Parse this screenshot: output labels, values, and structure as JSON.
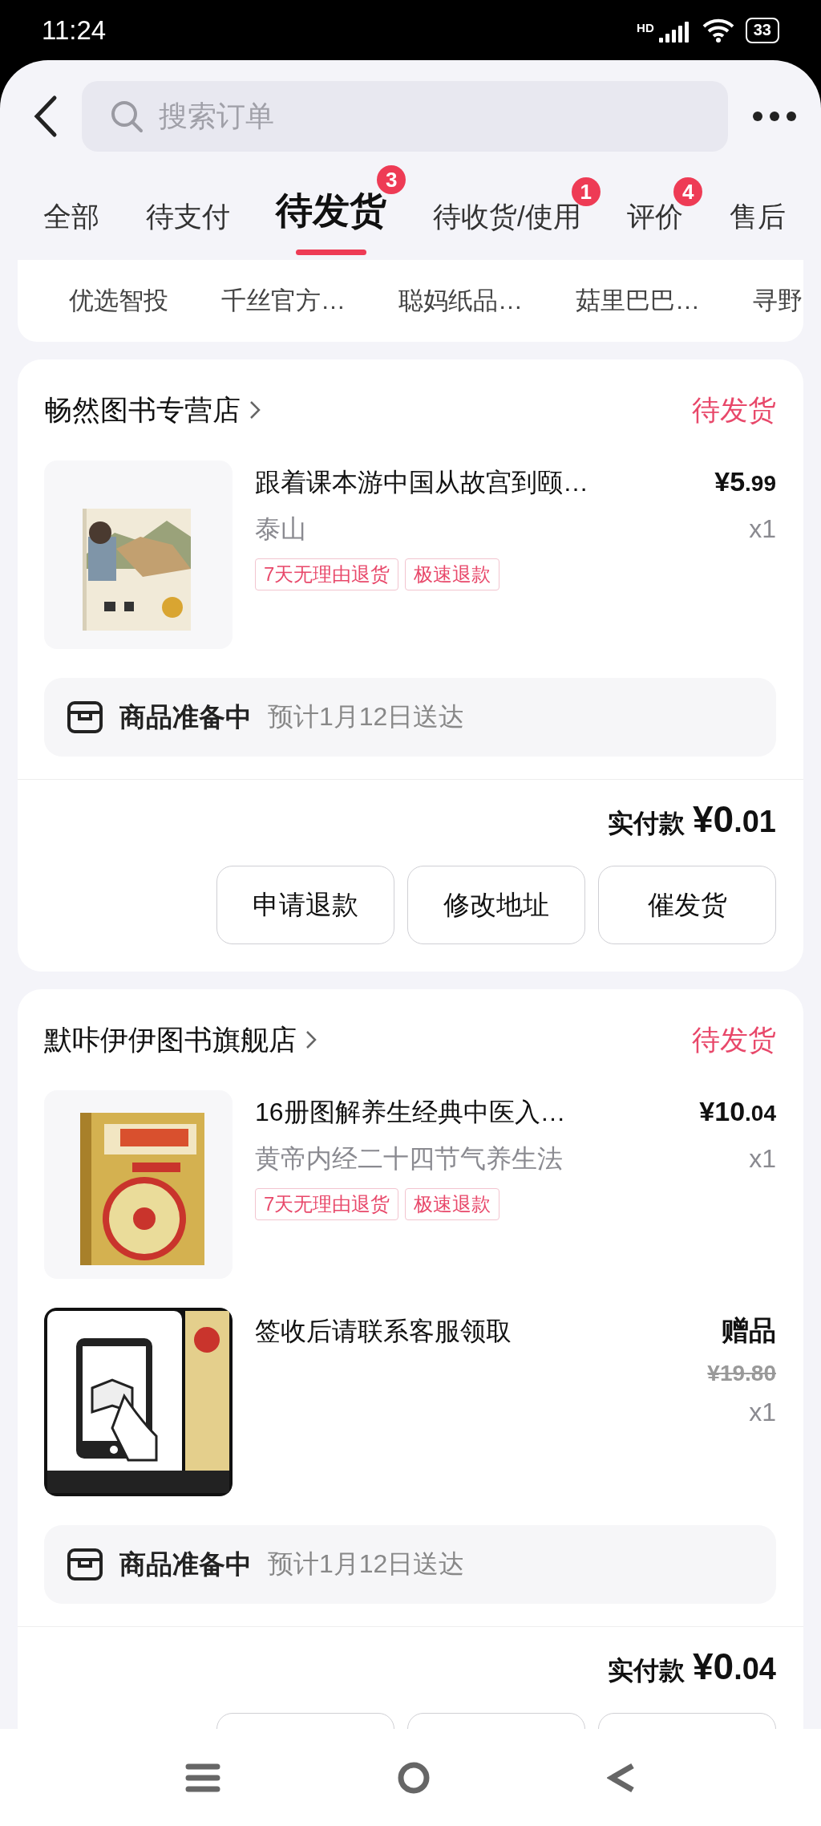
{
  "status_bar": {
    "time": "11:24",
    "network": "HD",
    "battery": "33"
  },
  "header": {
    "search": {
      "placeholder": "搜索订单"
    }
  },
  "tabs": [
    {
      "label": "全部",
      "selected": false
    },
    {
      "label": "待支付",
      "selected": false
    },
    {
      "label": "待发货",
      "selected": true,
      "badge": "3"
    },
    {
      "label": "待收货/使用",
      "selected": false,
      "badge": "1"
    },
    {
      "label": "评价",
      "selected": false,
      "badge": "4"
    },
    {
      "label": "售后",
      "selected": false
    }
  ],
  "shop_filters": [
    "优选智投",
    "千丝官方…",
    "聪妈纸品…",
    "菇里巴巴…",
    "寻野"
  ],
  "orders": [
    {
      "shop": "畅然图书专营店",
      "status": "待发货",
      "items": [
        {
          "kind": "product",
          "title": "跟着课本游中国从故宫到颐…",
          "variant": "泰山",
          "price_main": "¥5",
          "price_cents": ".99",
          "quantity": "x1",
          "tags": [
            "7天无理由退货",
            "极速退款"
          ]
        }
      ],
      "shipping": {
        "state": "商品准备中",
        "eta": "预计1月12日送达"
      },
      "total_label": "实付款",
      "total_main": "¥0",
      "total_cents": ".01",
      "buttons": [
        {
          "kind": "label",
          "label": "申请退款"
        },
        {
          "kind": "label",
          "label": "修改地址"
        },
        {
          "kind": "label",
          "label": "催发货"
        }
      ]
    },
    {
      "shop": "默咔伊伊图书旗舰店",
      "status": "待发货",
      "items": [
        {
          "kind": "product",
          "title": "16册图解养生经典中医入…",
          "variant": "黄帝内经二十四节气养生法",
          "price_main": "¥10",
          "price_cents": ".04",
          "quantity": "x1",
          "tags": [
            "7天无理由退货",
            "极速退款"
          ]
        },
        {
          "kind": "gift",
          "title": "签收后请联系客服领取",
          "gift_label": "赠品",
          "original_main": "¥19",
          "original_cents": ".80",
          "quantity": "x1"
        }
      ],
      "shipping": {
        "state": "商品准备中",
        "eta": "预计1月12日送达"
      },
      "total_label": "实付款",
      "total_main": "¥0",
      "total_cents": ".04",
      "buttons": [
        {
          "kind": "covered"
        },
        {
          "kind": "covered"
        },
        {
          "kind": "covered"
        }
      ]
    }
  ]
}
